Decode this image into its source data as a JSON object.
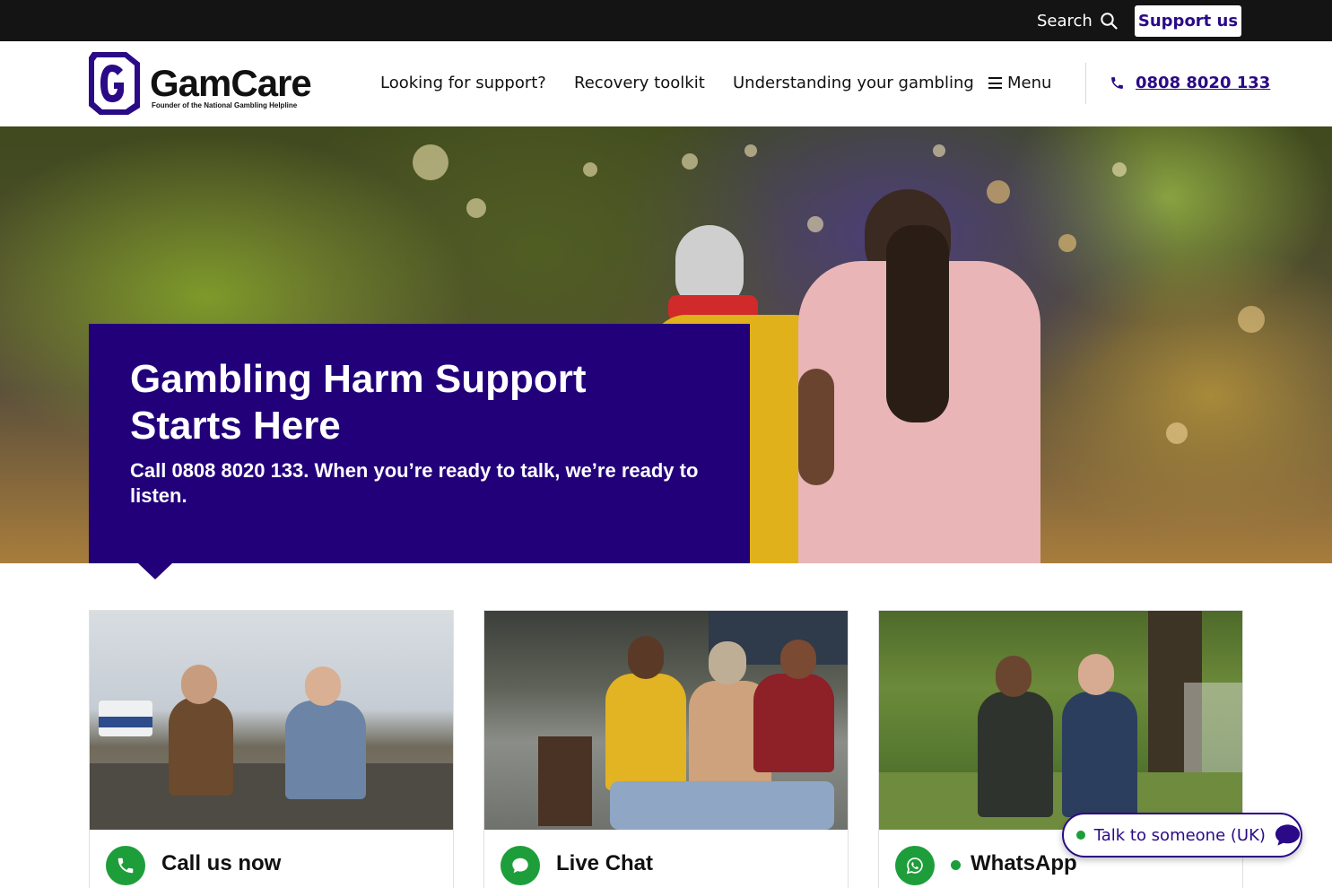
{
  "topbar": {
    "search_label": "Search",
    "support_label": "Support us"
  },
  "header": {
    "logo_word": "GamCare",
    "logo_tagline": "Founder of the National Gambling Helpline",
    "nav": [
      {
        "label": "Looking for support?"
      },
      {
        "label": "Recovery toolkit"
      },
      {
        "label": "Understanding your gambling"
      }
    ],
    "menu_label": "Menu",
    "phone": "0808 8020 133"
  },
  "hero": {
    "title": "Gambling Harm Support Starts Here",
    "subtitle": "Call 0808 8020 133. When you’re ready to talk, we’re ready to listen."
  },
  "cards": [
    {
      "title": "Call us now",
      "icon": "phone-icon"
    },
    {
      "title": "Live Chat",
      "icon": "chat-bubble-icon"
    },
    {
      "title": "WhatsApp",
      "icon": "whatsapp-icon"
    }
  ],
  "chat_widget": {
    "label": "Talk to someone (UK)"
  },
  "colors": {
    "brand_purple": "#22007a",
    "link_purple": "#2a0a86",
    "topbar_black": "#141414",
    "accent_green": "#1e9e3a"
  }
}
